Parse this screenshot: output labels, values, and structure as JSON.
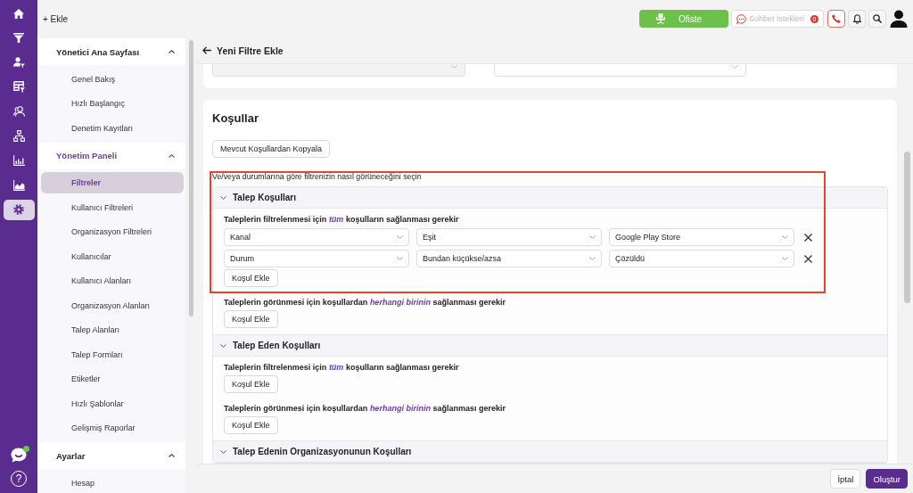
{
  "rail": {
    "items": [
      {
        "kind": "home",
        "selected": false
      },
      {
        "kind": "filter",
        "selected": false
      },
      {
        "kind": "user-filter",
        "selected": false
      },
      {
        "kind": "table-filter",
        "selected": false
      },
      {
        "kind": "users",
        "selected": false
      },
      {
        "kind": "hierarchy",
        "selected": false
      },
      {
        "kind": "bar-chart",
        "selected": false
      },
      {
        "kind": "area-chart",
        "selected": false
      },
      {
        "kind": "settings",
        "selected": true
      }
    ],
    "chat": {
      "online": true
    },
    "help": "?"
  },
  "topbar": {
    "add_button": "+ Ekle",
    "status_button": "Ofiste",
    "chat_requests": {
      "label": "Sohbet İstekleri",
      "count": "0",
      "disabled": true
    },
    "icon_buttons": [
      {
        "kind": "phone",
        "alert": true
      },
      {
        "kind": "bell",
        "alert": false
      },
      {
        "kind": "search",
        "alert": false
      }
    ]
  },
  "sidebar": {
    "sections": [
      {
        "title": "Yönetici Ana Sayfası",
        "active": false,
        "expanded": true,
        "items": [
          {
            "label": "Genel Bakış",
            "selected": false
          },
          {
            "label": "Hızlı Başlangıç",
            "selected": false
          },
          {
            "label": "Denetim Kayıtları",
            "selected": false
          }
        ]
      },
      {
        "title": "Yönetim Paneli",
        "active": true,
        "expanded": true,
        "items": [
          {
            "label": "Filtreler",
            "selected": true
          },
          {
            "label": "Kullanıcı Filtreleri",
            "selected": false
          },
          {
            "label": "Organizasyon Filtreleri",
            "selected": false
          },
          {
            "label": "Kullanıcılar",
            "selected": false
          },
          {
            "label": "Kullanıcı Alanları",
            "selected": false
          },
          {
            "label": "Organizasyon Alanları",
            "selected": false
          },
          {
            "label": "Talep Alanları",
            "selected": false
          },
          {
            "label": "Talep Formları",
            "selected": false
          },
          {
            "label": "Etiketler",
            "selected": false
          },
          {
            "label": "Hızlı Şablonlar",
            "selected": false
          },
          {
            "label": "Gelişmiş Raporlar",
            "selected": false
          }
        ]
      },
      {
        "title": "Ayarlar",
        "active": false,
        "expanded": true,
        "items": [
          {
            "label": "Hesap",
            "selected": false
          }
        ]
      }
    ]
  },
  "page": {
    "title": "Yeni Filtre Ekle"
  },
  "top_card": {
    "fields": [
      {
        "disabled": true
      },
      {
        "disabled": false
      }
    ]
  },
  "conditions": {
    "title": "Koşullar",
    "copy_button": "Mevcut Koşullardan Kopyala",
    "description": "Ve/veya durumlarına göre filtrenizin nasıl görüneceğini seçin",
    "highlight_box": true,
    "sections": [
      {
        "title": "Talep Koşulları",
        "expanded": true,
        "blocks": [
          {
            "label": "Taleplerin filtrelenmesi için *tüm* koşulların sağlanması gerekir",
            "rows": [
              {
                "field": "Kanal",
                "operator": "Eşit",
                "value": "Google Play Store"
              },
              {
                "field": "Durum",
                "operator": "Bundan küçükse/azsa",
                "value": "Çözüldü"
              }
            ],
            "add_button": "Koşul Ekle"
          },
          {
            "label": "Taleplerin görünmesi için koşullardan *herhangi birinin* sağlanması gerekir",
            "add_button": "Koşul Ekle"
          }
        ]
      },
      {
        "title": "Talep Eden Koşulları",
        "expanded": true,
        "blocks": [
          {
            "label": "Taleplerin filtrelenmesi için *tüm* koşulların sağlanması gerekir",
            "add_button": "Koşul Ekle"
          },
          {
            "label": "Taleplerin görünmesi için koşullardan *herhangi birinin* sağlanması gerekir",
            "add_button": "Koşul Ekle"
          }
        ]
      },
      {
        "title": "Talep Edenin Organizasyonunun Koşulları",
        "expanded": true
      }
    ]
  },
  "footer": {
    "buttons": [
      {
        "label": "İptal",
        "kind": "secondary"
      },
      {
        "label": "Oluştur",
        "kind": "primary"
      }
    ]
  }
}
